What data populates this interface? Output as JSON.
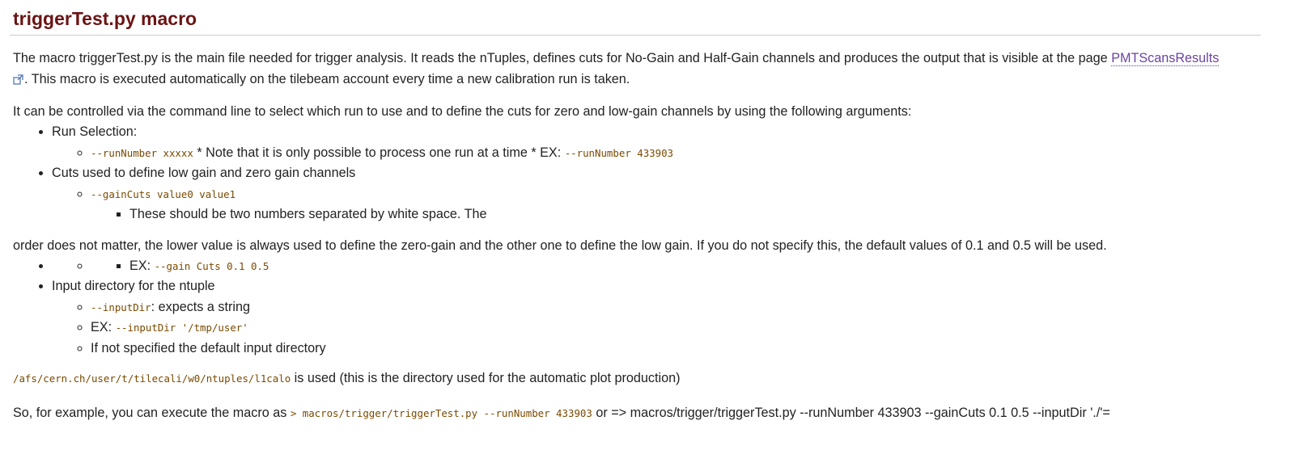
{
  "title": "triggerTest.py macro",
  "intro": {
    "text_before": "The macro triggerTest.py is the main file needed for trigger analysis. It reads the nTuples, defines cuts for No-Gain and Half-Gain channels and produces the output that is visible at the page ",
    "link": "PMTScansResults",
    "text_after": ". This macro is executed automatically on the tilebeam account every time a new calibration run is taken."
  },
  "control": "It can be controlled via the command line to select which run to use and to define the cuts for zero and low-gain channels by using the following arguments:",
  "list1": {
    "run_selection": "Run Selection:",
    "run_code": "--runNumber xxxxx",
    "run_note": " * Note that it is only possible to process one run at a time * EX: ",
    "run_example": "--runNumber 433903",
    "cuts_label": "Cuts used to define low gain and zero gain channels",
    "gain_code": "--gainCuts value0 value1",
    "gain_note": "These should be two numbers separated by white space. The"
  },
  "order": "order does not matter, the lower value is always used to define the zero-gain and the other one to define the low gain. If you do not specify this, the default values of 0.1 and 0.5 will be used.",
  "list2": {
    "ex_label": "EX: ",
    "ex_code": "--gain Cuts 0.1 0.5",
    "input_label": "Input directory for the ntuple",
    "input_code": "--inputDir",
    "input_desc": ": expects a string",
    "input_ex_label": "EX: ",
    "input_ex_code": "--inputDir '/tmp/user'",
    "input_default": "If not specified the default input directory"
  },
  "afs": {
    "path": "/afs/cern.ch/user/t/tilecali/w0/ntuples/l1calo",
    "text": " is used (this is the directory used for the automatic plot production)"
  },
  "example": {
    "text_before": "So, for example, you can execute the macro as ",
    "code": "> macros/trigger/triggerTest.py --runNumber 433903",
    "text_after": " or => macros/trigger/triggerTest.py --runNumber 433903 --gainCuts 0.1 0.5 --inputDir './'="
  },
  "colors": {
    "title": "#6b1414",
    "code": "#7a4a00",
    "link": "#6a44a0"
  },
  "icons": {
    "external_link": "external-link-icon"
  }
}
